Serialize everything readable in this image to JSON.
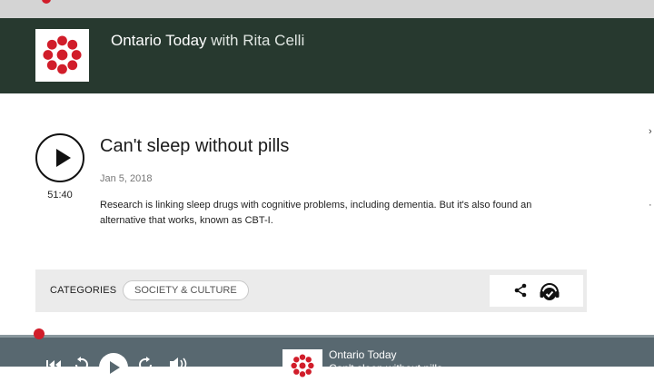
{
  "header": {
    "show_name": "Ontario Today",
    "host_text": "with Rita Celli",
    "logo_icon": "cbc-gem-logo-icon"
  },
  "episode": {
    "title": "Can't sleep without pills",
    "date": "Jan 5, 2018",
    "duration": "51:40",
    "description": "Research is linking sleep drugs with cognitive problems, including dementia. But it's also found an alternative that works, known as CBT-I."
  },
  "categories": {
    "label": "CATEGORIES",
    "items": [
      "SOCIETY & CULTURE"
    ]
  },
  "player": {
    "show_name": "Ontario Today",
    "episode_title": "Can't sleep without pills",
    "progress": 0.06
  },
  "colors": {
    "header_bg": "#27392f",
    "player_bg": "#586870",
    "cbc_red": "#d11d2a"
  }
}
